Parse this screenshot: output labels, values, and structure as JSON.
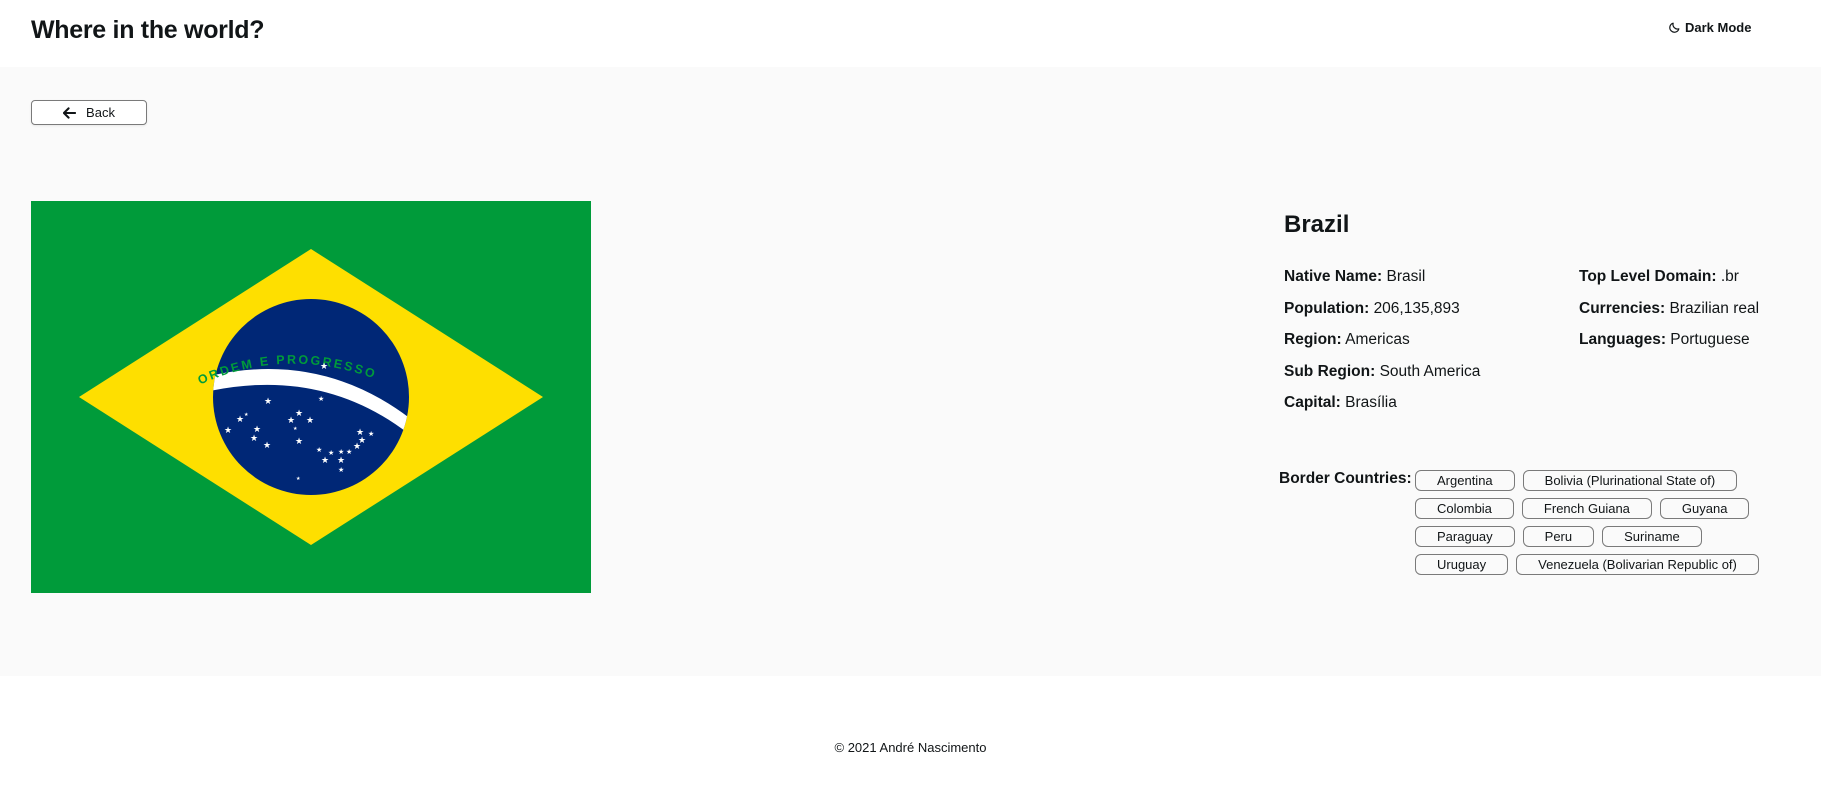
{
  "header": {
    "title": "Where in the world?",
    "mode_toggle_label": "Dark Mode",
    "mode_icon": "moon-icon"
  },
  "back_button": {
    "label": "Back",
    "icon": "arrow-left-icon"
  },
  "country": {
    "name": "Brazil",
    "flag_motto": "ORDEM E PROGRESSO",
    "details_left": [
      {
        "label": "Native Name:",
        "value": "Brasil"
      },
      {
        "label": "Population:",
        "value": "206,135,893"
      },
      {
        "label": "Region:",
        "value": "Americas"
      },
      {
        "label": "Sub Region:",
        "value": "South America"
      },
      {
        "label": "Capital:",
        "value": "Brasília"
      }
    ],
    "details_right": [
      {
        "label": "Top Level Domain:",
        "value": ".br"
      },
      {
        "label": "Currencies:",
        "value": "Brazilian real"
      },
      {
        "label": "Languages:",
        "value": "Portuguese"
      }
    ],
    "border_label": "Border Countries:",
    "border_countries": [
      "Argentina",
      "Bolivia (Plurinational State of)",
      "Colombia",
      "French Guiana",
      "Guyana",
      "Paraguay",
      "Peru",
      "Suriname",
      "Uruguay",
      "Venezuela (Bolivarian Republic of)"
    ]
  },
  "colors": {
    "flag_green": "#009B3A",
    "flag_yellow": "#FEDF00",
    "flag_blue": "#002776",
    "background": "#FAFAFA",
    "text": "#111517"
  },
  "footer": {
    "copyright": "© 2021 André Nascimento"
  }
}
